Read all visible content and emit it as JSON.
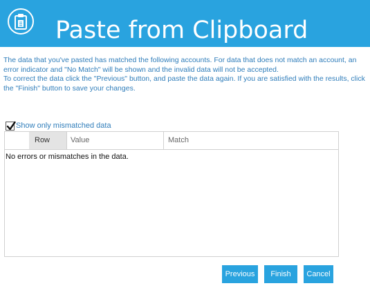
{
  "header": {
    "title": "Paste from Clipboard",
    "icon": "clipboard-icon",
    "background_color": "#29a3df"
  },
  "instructions": {
    "paragraph1": "The data that you've pasted has matched the following accounts. For data that does not match an account, an error indicator and \"No Match\" will be shown and the invalid data will not be accepted.",
    "paragraph2": "To correct the data click the \"Previous\" button, and paste the data again. If you are satisfied with the results, click the \"Finish\" button to save your changes."
  },
  "filter": {
    "label": "Show only mismatched data",
    "checked": true
  },
  "grid": {
    "columns": [
      "Row",
      "Value",
      "Match"
    ],
    "empty_message": "No errors or mismatches in the data."
  },
  "buttons": {
    "previous": "Previous",
    "finish": "Finish",
    "cancel": "Cancel",
    "color": "#29a3df"
  }
}
